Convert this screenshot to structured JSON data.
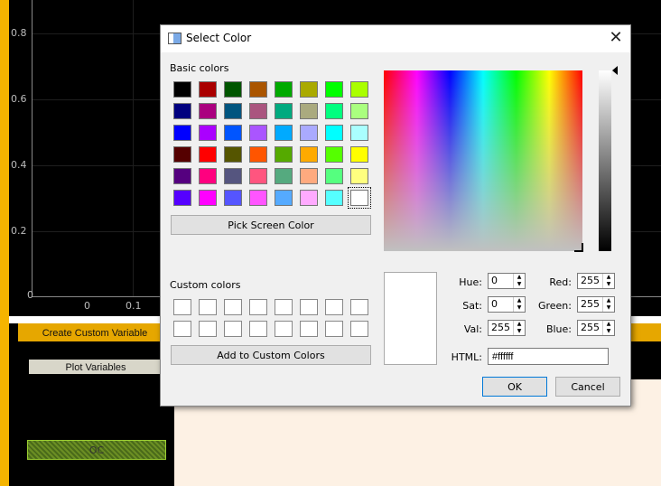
{
  "plot": {
    "y_ticks": [
      "0.8",
      "0.6",
      "0.4",
      "0.2",
      "0"
    ],
    "x_ticks": [
      "0",
      "0.1"
    ]
  },
  "app": {
    "create_custom_variable": "Create Custom Variable",
    "plot_variables": "Plot Variables",
    "bar_label": "OC"
  },
  "dialog": {
    "title": "Select Color",
    "close_glyph": "✕",
    "basic_colors_label": "Basic colors",
    "basic_colors": [
      [
        "#000000",
        "#aa0000",
        "#005500",
        "#aa5500",
        "#00aa00",
        "#aaaa00",
        "#00ff00",
        "#aaff00"
      ],
      [
        "#00007f",
        "#aa007f",
        "#00557f",
        "#aa557f",
        "#00aa7f",
        "#aaaa7f",
        "#00ff7f",
        "#aaff7f"
      ],
      [
        "#0000ff",
        "#aa00ff",
        "#0055ff",
        "#aa55ff",
        "#00aaff",
        "#aaaaff",
        "#00ffff",
        "#aaffff"
      ],
      [
        "#550000",
        "#ff0000",
        "#555500",
        "#ff5500",
        "#55aa00",
        "#ffaa00",
        "#55ff00",
        "#ffff00"
      ],
      [
        "#55007f",
        "#ff007f",
        "#55557f",
        "#ff557f",
        "#55aa7f",
        "#ffaa7f",
        "#55ff7f",
        "#ffff7f"
      ],
      [
        "#5500ff",
        "#ff00ff",
        "#5555ff",
        "#ff55ff",
        "#55aaff",
        "#ffaaff",
        "#55ffff",
        "#ffffff"
      ]
    ],
    "selected_swatch": "#ffffff",
    "pick_screen_color": "Pick Screen Color",
    "custom_colors_label": "Custom colors",
    "add_to_custom_colors": "Add to Custom Colors",
    "fields": {
      "hue": {
        "label": "Hue:",
        "value": "0"
      },
      "sat": {
        "label": "Sat:",
        "value": "0"
      },
      "val": {
        "label": "Val:",
        "value": "255"
      },
      "red": {
        "label": "Red:",
        "value": "255"
      },
      "green": {
        "label": "Green:",
        "value": "255"
      },
      "blue": {
        "label": "Blue:",
        "value": "255"
      }
    },
    "html_label": "HTML:",
    "html_value": "#ffffff",
    "ok": "OK",
    "cancel": "Cancel"
  }
}
